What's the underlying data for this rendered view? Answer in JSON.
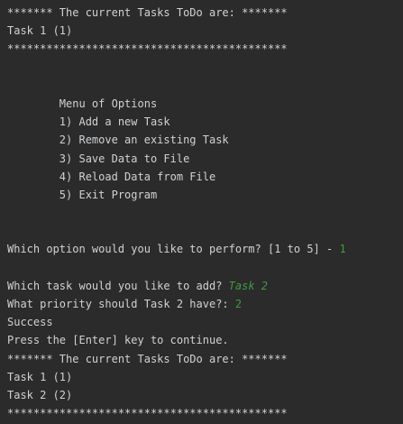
{
  "console": {
    "header_1": "******* The current Tasks ToDo are: *******",
    "task_list_1": [
      "Task 1 (1)"
    ],
    "separator_1": "*******************************************",
    "menu": {
      "title": "Menu of Options",
      "options": [
        "1) Add a new Task",
        "2) Remove an existing Task",
        "3) Save Data to File",
        "4) Reload Data from File",
        "5) Exit Program"
      ]
    },
    "option_prompt": "Which option would you like to perform? [1 to 5] - ",
    "option_input": "1",
    "task_prompt": "Which task would you like to add? ",
    "task_input": "Task 2",
    "priority_prompt": "What priority should Task 2 have?: ",
    "priority_input": "2",
    "success_text": "Success",
    "continue_text": "Press the [Enter] key to continue.",
    "header_2": "******* The current Tasks ToDo are: *******",
    "task_list_2": [
      "Task 1 (1)",
      "Task 2 (2)"
    ],
    "separator_2": "*******************************************"
  },
  "colors": {
    "background": "#2b2b2b",
    "text": "#cfd2d6",
    "user_input": "#3f9b3f"
  }
}
